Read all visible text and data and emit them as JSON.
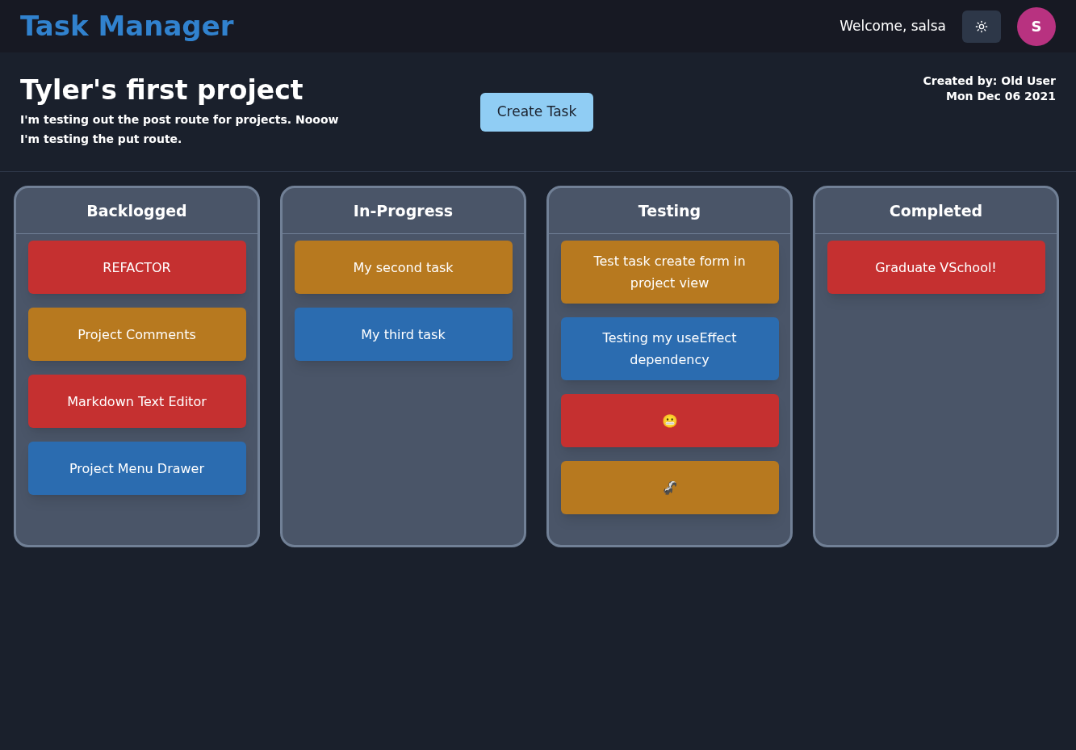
{
  "app_title": "Task Manager",
  "header": {
    "welcome": "Welcome, salsa",
    "avatar_initial": "S"
  },
  "project": {
    "title": "Tyler's first project",
    "description": "I'm testing out the post route for projects. Nooow I'm testing the put route.",
    "create_button": "Create Task",
    "created_by": "Created by: Old User",
    "created_date": "Mon Dec 06 2021"
  },
  "columns": [
    {
      "title": "Backlogged",
      "tasks": [
        {
          "title": "REFACTOR",
          "color": "#c53030"
        },
        {
          "title": "Project Comments",
          "color": "#b7791f"
        },
        {
          "title": "Markdown Text Editor",
          "color": "#c53030"
        },
        {
          "title": "Project Menu Drawer",
          "color": "#2b6cb0"
        }
      ]
    },
    {
      "title": "In-Progress",
      "tasks": [
        {
          "title": "My second task",
          "color": "#b7791f"
        },
        {
          "title": "My third task",
          "color": "#2b6cb0"
        }
      ]
    },
    {
      "title": "Testing",
      "tasks": [
        {
          "title": "Test task create form in project view",
          "color": "#b7791f"
        },
        {
          "title": "Testing my useEffect dependency",
          "color": "#2b6cb0"
        },
        {
          "title": "😬",
          "color": "#c53030"
        },
        {
          "title": "🦨",
          "color": "#b7791f"
        }
      ]
    },
    {
      "title": "Completed",
      "tasks": [
        {
          "title": "Graduate VSchool!",
          "color": "#c53030"
        }
      ]
    }
  ]
}
